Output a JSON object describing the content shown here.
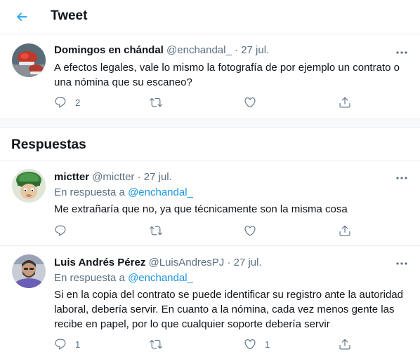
{
  "header": {
    "title": "Tweet",
    "back_icon": "arrow-left-icon"
  },
  "main_tweet": {
    "name": "Domingos en chándal",
    "handle": "@enchandal_",
    "separator": "·",
    "date": "27 jul.",
    "text_line1": "A efectos legales, vale lo mismo la fotografía de por ejemplo un contrato o",
    "text_line2": "una nómina que su escaneo?",
    "reply_count": "2",
    "retweet_count": "",
    "like_count": ""
  },
  "replies_section": {
    "title": "Respuestas"
  },
  "replies": [
    {
      "name": "mictter",
      "handle": "@mictter",
      "separator": "·",
      "date": "27 jul.",
      "replying_prefix": "En respuesta a",
      "replying_to": "@enchandal_",
      "text_line1": "Me extrañaría que no, ya que técnicamente son la misma cosa",
      "reply_count": "",
      "retweet_count": "",
      "like_count": ""
    },
    {
      "name": "Luis Andrés Pérez",
      "handle": "@LuisAndresPJ",
      "separator": "·",
      "date": "27 jul.",
      "replying_prefix": "En respuesta a",
      "replying_to": "@enchandal_",
      "text_line1": "Si en la copia del contrato se puede identificar su registro ante la autoridad",
      "text_line2": "laboral, debería servir. En cuanto a la nómina, cada vez menos gente las",
      "text_line3": "recibe en papel, por lo que cualquier soporte debería servir",
      "reply_count": "1",
      "retweet_count": "",
      "like_count": "1"
    }
  ],
  "colors": {
    "accent": "#1da1f2",
    "secondary_text": "#5b7083",
    "border": "#ebeef0"
  }
}
